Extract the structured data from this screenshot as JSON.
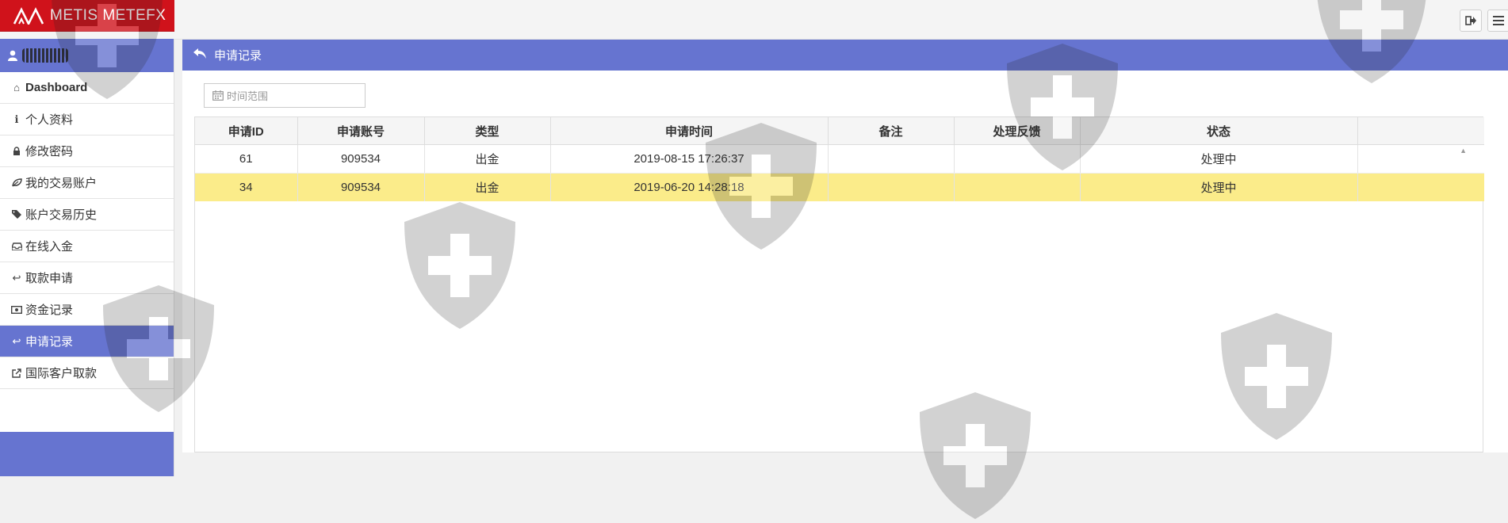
{
  "brand": {
    "name": "METIS METEFX"
  },
  "topbar": {
    "logout_icon": "sign-out-icon",
    "menu_icon": "bars-icon"
  },
  "user": {
    "icon": "user-icon"
  },
  "sidebar": {
    "items": [
      {
        "label": "Dashboard",
        "icon": "home-icon",
        "glyph": "⌂"
      },
      {
        "label": "个人资料",
        "icon": "info-icon",
        "glyph": "ℹ"
      },
      {
        "label": "修改密码",
        "icon": "lock-icon",
        "glyph": "🔒"
      },
      {
        "label": "我的交易账户",
        "icon": "leaf-icon",
        "glyph": "❦"
      },
      {
        "label": "账户交易历史",
        "icon": "tags-icon",
        "glyph": "🏷"
      },
      {
        "label": "在线入金",
        "icon": "inbox-icon",
        "glyph": "⎙"
      },
      {
        "label": "取款申请",
        "icon": "reply-icon",
        "glyph": "↩"
      },
      {
        "label": "资金记录",
        "icon": "money-icon",
        "glyph": "▣"
      },
      {
        "label": "申请记录",
        "icon": "reply-icon",
        "glyph": "↩",
        "active": true
      },
      {
        "label": "国际客户取款",
        "icon": "external-link-icon",
        "glyph": "⇗"
      }
    ]
  },
  "page": {
    "title": "申请记录",
    "title_icon": "reply-icon"
  },
  "filter": {
    "placeholder": "时间范围",
    "icon": "calendar-icon"
  },
  "table": {
    "columns": [
      "申请ID",
      "申请账号",
      "类型",
      "申请时间",
      "备注",
      "处理反馈",
      "状态"
    ],
    "rows": [
      [
        "61",
        "909534",
        "出金",
        "2019-08-15 17:26:37",
        "",
        "",
        "处理中"
      ],
      [
        "34",
        "909534",
        "出金",
        "2019-06-20 14:28:18",
        "",
        "",
        "处理中"
      ]
    ]
  },
  "colors": {
    "accent": "#6674d0",
    "brand_red": "#d0121b",
    "highlight_row": "#fbec8a"
  }
}
